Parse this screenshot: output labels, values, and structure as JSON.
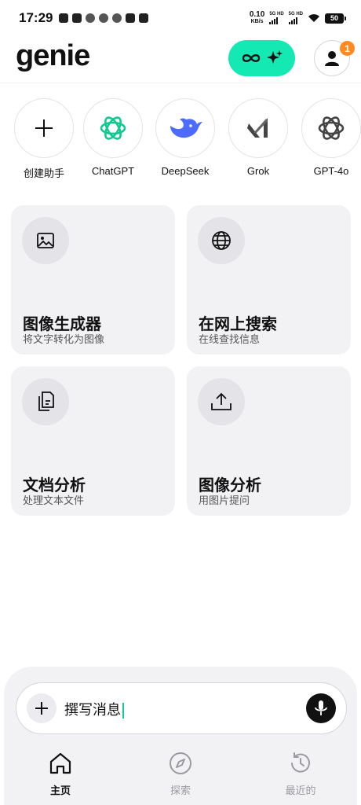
{
  "status_bar": {
    "time": "17:29",
    "net_speed_value": "0.10",
    "net_speed_unit": "KB/s",
    "signal_1_label": "5G HD",
    "signal_2_label": "5G HD",
    "battery": "50"
  },
  "header": {
    "logo": "genie",
    "notification_count": "1"
  },
  "assistants": [
    {
      "label": "创建助手",
      "icon": "plus-icon"
    },
    {
      "label": "ChatGPT",
      "icon": "chatgpt-logo-icon",
      "color": "#10c990"
    },
    {
      "label": "DeepSeek",
      "icon": "deepseek-whale-icon",
      "color": "#4d6bfe"
    },
    {
      "label": "Grok",
      "icon": "grok-logo-icon",
      "color": "#444444"
    },
    {
      "label": "GPT-4o",
      "icon": "openai-logo-icon",
      "color": "#444444"
    }
  ],
  "features": [
    {
      "title": "图像生成器",
      "subtitle": "将文字转化为图像",
      "icon": "image-icon"
    },
    {
      "title": "在网上搜索",
      "subtitle": "在线查找信息",
      "icon": "globe-icon"
    },
    {
      "title": "文档分析",
      "subtitle": "处理文本文件",
      "icon": "document-icon"
    },
    {
      "title": "图像分析",
      "subtitle": "用图片提问",
      "icon": "upload-icon"
    }
  ],
  "composer": {
    "text": "撰写消息"
  },
  "tabs": [
    {
      "label": "主页",
      "icon": "home-icon",
      "active": true
    },
    {
      "label": "探索",
      "icon": "compass-icon",
      "active": false
    },
    {
      "label": "最近的",
      "icon": "history-icon",
      "active": false
    }
  ],
  "colors": {
    "accent": "#14e8b3",
    "badge": "#ff8a1f",
    "card_bg": "#f2f2f5"
  }
}
